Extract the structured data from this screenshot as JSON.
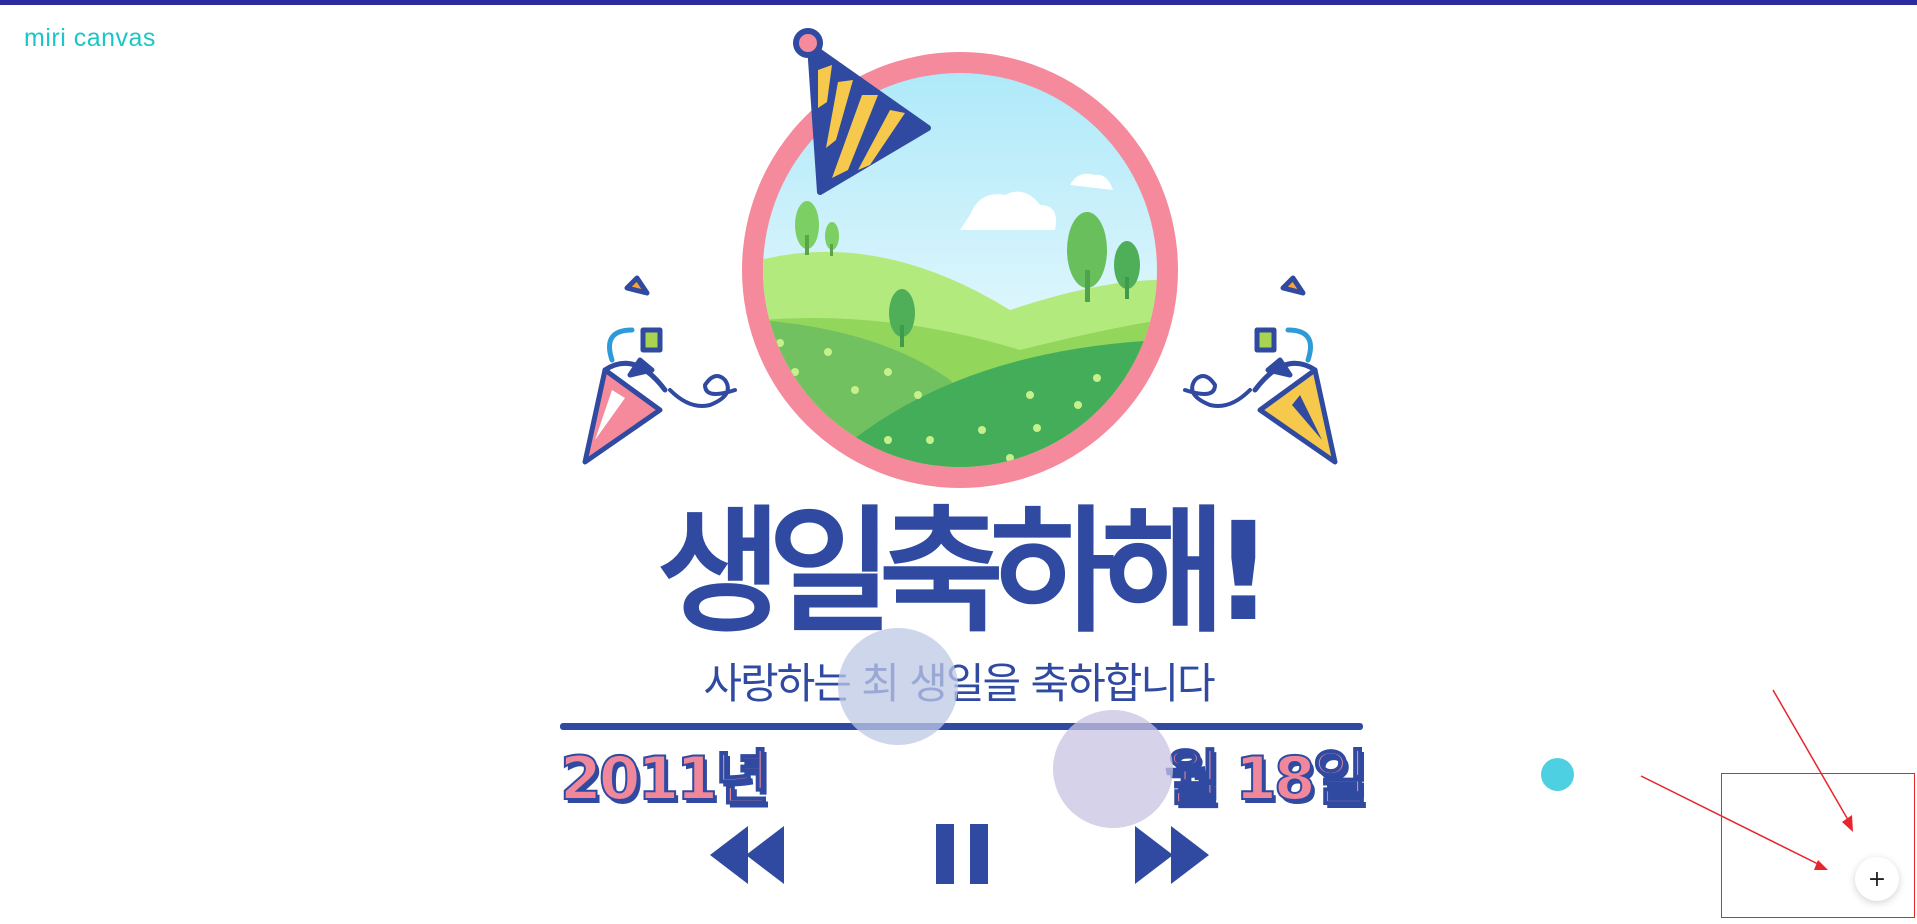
{
  "app": {
    "logo": "miri canvas"
  },
  "card": {
    "title": "생일축하해!",
    "subtitle": "사랑하는 최 생일을 축하합니다",
    "year_text": "2011년",
    "day_text": "월 18일"
  },
  "controls": {
    "rewind_icon": "rewind-icon",
    "pause_icon": "pause-icon",
    "fast_forward_icon": "fast-forward-icon"
  },
  "fab": {
    "label": "+"
  },
  "colors": {
    "brand_navy": "#2f4aa0",
    "pink": "#f1879a",
    "accent_cyan": "#1bc6c8",
    "annotation_red": "#e8242c",
    "top_bar": "#2b2a9e"
  }
}
